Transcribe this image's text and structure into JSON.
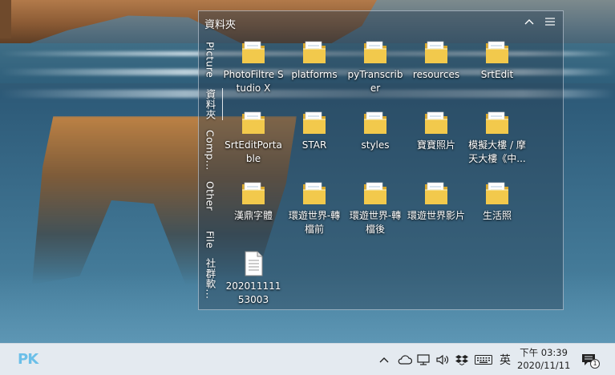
{
  "fence": {
    "title": "資料夾",
    "collapse_icon": "chevron-up-icon",
    "menu_icon": "hamburger-icon"
  },
  "tabs": [
    {
      "label": "Picture",
      "active": false
    },
    {
      "label": "資料夾",
      "active": true
    },
    {
      "label": "Comp...",
      "active": false
    },
    {
      "label": "Other",
      "active": false
    },
    {
      "label": "File",
      "active": false
    },
    {
      "label": "社群軟...",
      "active": false
    }
  ],
  "items": [
    {
      "label": "PhotoFiltre Studio X",
      "icon": "folder-icon"
    },
    {
      "label": "platforms",
      "icon": "folder-icon"
    },
    {
      "label": "pyTranscriber",
      "icon": "folder-icon"
    },
    {
      "label": "resources",
      "icon": "folder-icon"
    },
    {
      "label": "SrtEdit",
      "icon": "folder-icon"
    },
    {
      "label": "SrtEditPortable",
      "icon": "folder-icon"
    },
    {
      "label": "STAR",
      "icon": "folder-icon"
    },
    {
      "label": "styles",
      "icon": "folder-icon"
    },
    {
      "label": "寶寶照片",
      "icon": "folder-icon"
    },
    {
      "label": "模擬大樓 / 摩天大樓《中...",
      "icon": "folder-icon"
    },
    {
      "label": "漢鼎字體",
      "icon": "folder-icon"
    },
    {
      "label": "環遊世界-轉檔前",
      "icon": "folder-icon"
    },
    {
      "label": "環遊世界-轉檔後",
      "icon": "folder-icon"
    },
    {
      "label": "環遊世界影片",
      "icon": "folder-icon"
    },
    {
      "label": "生活照",
      "icon": "folder-icon"
    },
    {
      "label": "20201111153003",
      "icon": "text-file-icon"
    }
  ],
  "taskbar": {
    "logo": "PK",
    "ime": "英",
    "clock_time": "下午 03:39",
    "clock_date": "2020/11/11",
    "notification_count": "1"
  },
  "colors": {
    "folder": "#f2c94c",
    "folder_dark": "#d9a92c",
    "accent": "#6bbfe8"
  }
}
